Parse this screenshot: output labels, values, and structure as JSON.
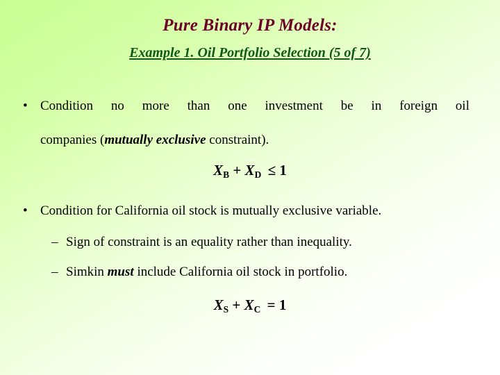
{
  "slide": {
    "title": "Pure Binary IP Models:",
    "subtitle": "Example 1. Oil Portfolio Selection (5 of 7)",
    "title_color": "#6B0029",
    "subtitle_color": "#11571A",
    "background_top_left_color": "#CCFF99",
    "background_bottom_right_color": "#FFFFFF",
    "body_text_color": "#000000"
  },
  "body": {
    "bullet1": {
      "marker": "•",
      "line1": "Condition no  more  than  one  investment  be  in  foreign  oil",
      "line2_before_emphasis": "companies (",
      "line2_emphasis": "mutually exclusive",
      "line2_after_emphasis": " constraint)."
    },
    "equation1": {
      "left_var": "X",
      "left_sub": "B",
      "plus": "+",
      "right_var": "X",
      "right_sub": "D",
      "relation": "≤",
      "value": "1"
    },
    "bullet2": {
      "marker": "•",
      "text": "Condition for California oil stock is mutually exclusive variable."
    },
    "subbullet1": {
      "marker": "–",
      "text": "Sign of constraint is an equality rather than inequality."
    },
    "subbullet2": {
      "marker": "–",
      "text_before_emphasis": "Simkin ",
      "emphasis": "must",
      "text_after_emphasis": " include California oil stock in  portfolio."
    },
    "equation2": {
      "left_var": "X",
      "left_sub": "S",
      "plus": "+",
      "right_var": "X",
      "right_sub": "C",
      "relation": "=",
      "value": "1"
    }
  }
}
